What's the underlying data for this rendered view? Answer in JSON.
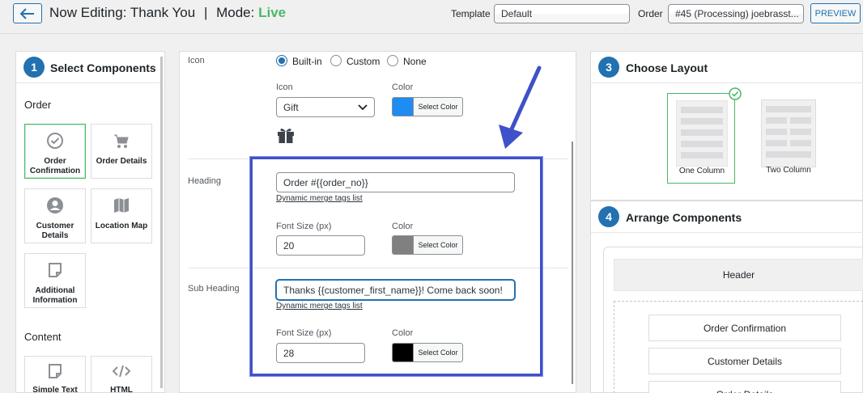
{
  "header": {
    "title_prefix": "Now Editing:",
    "title_name": "Thank You",
    "separator": "|",
    "mode_label": "Mode:",
    "mode_value": "Live",
    "template_label": "Template",
    "template_value": "Default",
    "order_label": "Order",
    "order_value": "#45 (Processing) joebrasst...",
    "preview_label": "PREVIEW"
  },
  "components": {
    "step": "1",
    "title": "Select Components",
    "order_section": "Order",
    "order_tiles": [
      {
        "label": "Order Confirmation",
        "icon": "check-circle-icon",
        "active": true
      },
      {
        "label": "Order Details",
        "icon": "cart-icon",
        "active": false
      },
      {
        "label": "Customer Details",
        "icon": "user-circle-icon",
        "active": false
      },
      {
        "label": "Location Map",
        "icon": "map-icon",
        "active": false
      },
      {
        "label": "Additional Information",
        "icon": "note-icon",
        "active": false
      }
    ],
    "content_section": "Content",
    "content_tiles": [
      {
        "label": "Simple Text",
        "icon": "note-icon"
      },
      {
        "label": "HTML",
        "icon": "code-icon"
      }
    ]
  },
  "editor": {
    "icon_section_label": "Icon",
    "icon_options": [
      "Built-in",
      "Custom",
      "None"
    ],
    "icon_selected": "Built-in",
    "icon_field_label": "Icon",
    "icon_value": "Gift",
    "icon_color_label": "Color",
    "icon_color": "#1e8cf0",
    "select_color_label": "Select Color",
    "heading_label": "Heading",
    "heading_value": "Order #{{order_no}}",
    "merge_tags_link": "Dynamic merge tags list",
    "heading_font_label": "Font Size (px)",
    "heading_font_value": "20",
    "heading_color_label": "Color",
    "heading_color": "#808080",
    "subheading_label": "Sub Heading",
    "subheading_value": "Thanks {{customer_first_name}}! Come back soon!",
    "subheading_font_label": "Font Size (px)",
    "subheading_font_value": "28",
    "subheading_color_label": "Color",
    "subheading_color": "#000000"
  },
  "layout": {
    "step": "3",
    "title": "Choose Layout",
    "options": [
      {
        "label": "One Column",
        "active": true
      },
      {
        "label": "Two Column",
        "active": false
      }
    ]
  },
  "arrange": {
    "step": "4",
    "title": "Arrange Components",
    "header_label": "Header",
    "items": [
      "Order Confirmation",
      "Customer Details",
      "Order Details"
    ]
  },
  "colors": {
    "accent": "#2271b1",
    "live": "#4ab866",
    "highlight": "#3f51c8"
  }
}
